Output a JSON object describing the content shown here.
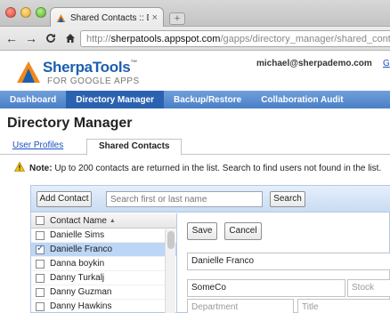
{
  "browser": {
    "tab_title": "Shared Contacts :: Directory",
    "tab_close": "×",
    "new_tab": "+",
    "url_protocol": "http://",
    "url_host": "sherpatools.appspot.com",
    "url_path": "/gapps/directory_manager/shared_cont"
  },
  "header": {
    "logo_name": "SherpaTools",
    "logo_tm": "™",
    "logo_sub": "FOR GOOGLE APPS",
    "user_email": "michael@sherpademo.com",
    "user_link": "G"
  },
  "nav": {
    "items": [
      "Dashboard",
      "Directory Manager",
      "Backup/Restore",
      "Collaboration Audit"
    ]
  },
  "page": {
    "title": "Directory Manager",
    "tabs": [
      "User Profiles",
      "Shared Contacts"
    ],
    "notice_label": "Note:",
    "notice_text": " Up to 200 contacts are returned in the list. Search to find users not found in the list."
  },
  "toolbar": {
    "add_contact": "Add Contact",
    "search_placeholder": "Search first or last name",
    "search_button": "Search"
  },
  "list": {
    "header": "Contact Name",
    "sort_glyph": "▲",
    "rows": [
      {
        "name": "Danielle Sims",
        "checked": false
      },
      {
        "name": "Danielle Franco",
        "checked": true
      },
      {
        "name": "Danna boykin",
        "checked": false
      },
      {
        "name": "Danny Turkalj",
        "checked": false
      },
      {
        "name": "Danny Guzman",
        "checked": false
      },
      {
        "name": "Danny Hawkins",
        "checked": false
      }
    ]
  },
  "detail": {
    "save": "Save",
    "cancel": "Cancel",
    "name_value": "Danielle Franco",
    "company_value": "SomeCo",
    "stock_placeholder": "Stock",
    "department_placeholder": "Department",
    "title_placeholder": "Title"
  },
  "colors": {
    "nav_bg": "#4a7fc6",
    "nav_active": "#2b62b0",
    "link": "#1a4fc4",
    "selected_row": "#bcd6f5"
  }
}
